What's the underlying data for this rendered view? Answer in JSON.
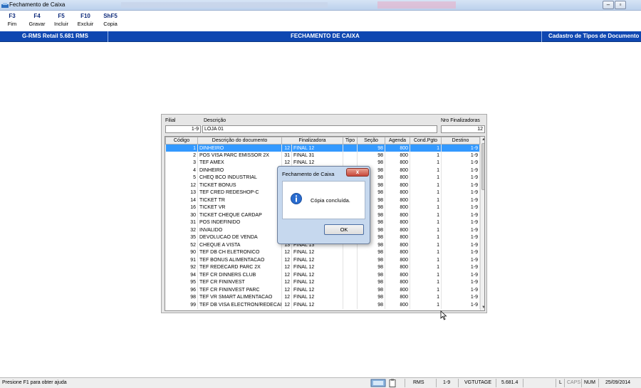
{
  "window": {
    "title": "Fechamento de Caixa"
  },
  "fkeys": [
    {
      "key": "F3",
      "label": "Fim"
    },
    {
      "key": "F4",
      "label": "Gravar"
    },
    {
      "key": "F5",
      "label": "Incluir"
    },
    {
      "key": "F10",
      "label": "Excluir"
    },
    {
      "key": "ShF5",
      "label": "Copia"
    }
  ],
  "header": {
    "left": "G-RMS Retail 5.681 RMS",
    "center": "FECHAMENTO DE CAIXA",
    "right": "Cadastro de Tipos de Documento"
  },
  "form": {
    "filial_label": "Filial",
    "descricao_label": "Descrição",
    "nro_label": "Nro Finalizadoras",
    "filial_value": "1-9",
    "descricao_value": "LOJA 01",
    "nro_value": "12"
  },
  "table": {
    "columns": [
      "Código",
      "Descrição do documento",
      "Finalizadora",
      "Tipo",
      "Seção",
      "Agenda",
      "Cond.Pgto",
      "Destino"
    ],
    "rows": [
      [
        "1",
        "DINHEIRO",
        "12",
        "FINAL 12",
        "",
        "98",
        "800",
        "1",
        "1-9"
      ],
      [
        "2",
        "POS VISA PARC EMISSOR  2X",
        "31",
        "FINAL 31",
        "",
        "98",
        "800",
        "1",
        "1-9"
      ],
      [
        "3",
        "TEF AMEX",
        "12",
        "FINAL 12",
        "",
        "98",
        "800",
        "1",
        "1-9"
      ],
      [
        "4",
        "DINHEIRO",
        "",
        "",
        "",
        "98",
        "800",
        "1",
        "1-9"
      ],
      [
        "5",
        "CHEQ BCO INDUSTRIAL",
        "",
        "",
        "",
        "98",
        "800",
        "1",
        "1-9"
      ],
      [
        "12",
        "TICKET BONUS",
        "",
        "",
        "",
        "98",
        "800",
        "1",
        "1-9"
      ],
      [
        "13",
        "TEF CRED REDESHOP-C",
        "",
        "",
        "",
        "98",
        "800",
        "1",
        "1-9"
      ],
      [
        "14",
        "TICKET TR",
        "",
        "",
        "",
        "98",
        "800",
        "1",
        "1-9"
      ],
      [
        "16",
        "TICKET VR",
        "",
        "",
        "",
        "98",
        "800",
        "1",
        "1-9"
      ],
      [
        "30",
        "TICKET CHEQUE CARDAP",
        "",
        "",
        "",
        "98",
        "800",
        "1",
        "1-9"
      ],
      [
        "31",
        "POS INDEFINIDO",
        "",
        "",
        "",
        "98",
        "800",
        "1",
        "1-9"
      ],
      [
        "32",
        "INVALIDO",
        "",
        "",
        "",
        "98",
        "800",
        "1",
        "1-9"
      ],
      [
        "35",
        "DEVOLUCAO DE VENDA",
        "",
        "",
        "",
        "98",
        "800",
        "1",
        "1-9"
      ],
      [
        "52",
        "CHEQUE A VISTA",
        "13",
        "FINAL 13",
        "",
        "98",
        "800",
        "1",
        "1-9"
      ],
      [
        "90",
        "TEF DB CH ELETRONICO",
        "12",
        "FINAL 12",
        "",
        "98",
        "800",
        "1",
        "1-9"
      ],
      [
        "91",
        "TEF BONUS ALIMENTACAO",
        "12",
        "FINAL 12",
        "",
        "98",
        "800",
        "1",
        "1-9"
      ],
      [
        "92",
        "TEF REDECARD PARC 2X",
        "12",
        "FINAL 12",
        "",
        "98",
        "800",
        "1",
        "1-9"
      ],
      [
        "94",
        "TEF CR DINNERS CLUB",
        "12",
        "FINAL 12",
        "",
        "98",
        "800",
        "1",
        "1-9"
      ],
      [
        "95",
        "TEF CR FININVEST",
        "12",
        "FINAL 12",
        "",
        "98",
        "800",
        "1",
        "1-9"
      ],
      [
        "96",
        "TEF CR FININVEST PARC",
        "12",
        "FINAL 12",
        "",
        "98",
        "800",
        "1",
        "1-9"
      ],
      [
        "98",
        "TEF VR SMART ALIMENTACAO",
        "12",
        "FINAL 12",
        "",
        "98",
        "800",
        "1",
        "1-9"
      ],
      [
        "99",
        "TEF DB VISA ELECTRON/REDECARD",
        "12",
        "FINAL 12",
        "",
        "98",
        "800",
        "1",
        "1-9"
      ]
    ]
  },
  "dialog": {
    "title": "Fechamento de Caixa",
    "close": "x",
    "message": "Cópia concluída.",
    "ok_label": "OK"
  },
  "statusbar": {
    "help": "Presione F1 para obter ajuda",
    "system": "RMS",
    "filial": "1-9",
    "user": "VGTUTAGE",
    "version": "5.681.4",
    "l": "L",
    "caps": "CAPS",
    "num": "NUM",
    "date": "25/09/2014"
  },
  "colors": {
    "header_blue": "#0f47b1",
    "selection": "#3399ff"
  },
  "icons": [
    "app-icon",
    "info-icon",
    "network-icon",
    "clipboard-icon",
    "scroll-up-icon",
    "scroll-down-icon"
  ]
}
